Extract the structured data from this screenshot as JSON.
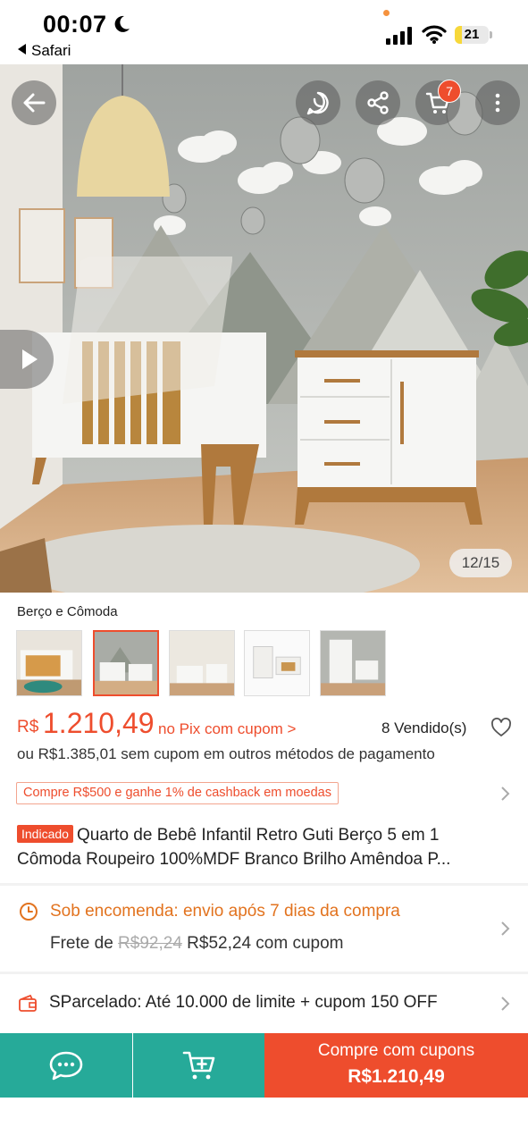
{
  "status_bar": {
    "time": "00:07",
    "back_app": "Safari",
    "battery": "21",
    "battery_level": 0.21,
    "icons": [
      "moon-icon",
      "signal-icon",
      "wifi-icon",
      "battery-icon"
    ]
  },
  "hero": {
    "counter": "12/15",
    "cart_badge": "7",
    "buttons": [
      "back-arrow-icon",
      "whatsapp-icon",
      "share-icon",
      "cart-icon",
      "more-icon"
    ]
  },
  "variation": {
    "label": "Berço e Cômoda",
    "thumbnails": 5,
    "selected_index": 1
  },
  "price": {
    "currency": "R$",
    "value": "1.210,49",
    "note": "no Pix com cupom >",
    "sold": "8 Vendido(s)",
    "alt_price": "ou R$1.385,01 sem cupom em outros métodos de pagamento",
    "cashback": "Compre R$500 e ganhe 1% de cashback em moedas"
  },
  "product": {
    "tag": "Indicado",
    "title_line1": "Quarto de Bebê Infantil Retro Guti Berço 5 em 1",
    "title_line2": "Cômoda Roupeiro 100%MDF Branco Brilho Amêndoa P..."
  },
  "shipping": {
    "title": "Sob encomenda: envio após 7 dias da compra",
    "label": "Frete de",
    "old_price": "R$92,24",
    "new_price": "R$52,24 com cupom"
  },
  "sparcelado": {
    "text": "SParcelado: Até 10.000 de limite + cupom 150 OFF"
  },
  "bottom_bar": {
    "buy_label": "Compre com cupons",
    "buy_price": "R$1.210,49"
  },
  "colors": {
    "accent": "#ee4d2d",
    "teal": "#26aa99",
    "shipping": "#e2731f"
  }
}
